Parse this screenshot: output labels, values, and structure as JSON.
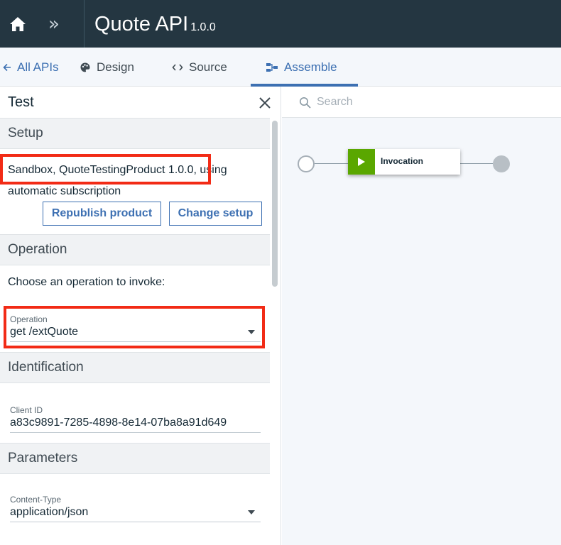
{
  "header": {
    "title": "Quote API",
    "version": "1.0.0"
  },
  "nav": {
    "all_apis": "All APIs",
    "design": "Design",
    "source": "Source",
    "assemble": "Assemble"
  },
  "test_panel": {
    "title": "Test",
    "setup": {
      "heading": "Setup",
      "line1_highlight": "Sandbox, QuoteTestingProduct 1.0.0,",
      "line1_rest": " using",
      "line2": "automatic subscription",
      "republish_label": "Republish product",
      "change_setup_label": "Change setup"
    },
    "operation": {
      "heading": "Operation",
      "prompt": "Choose an operation to invoke:",
      "field_label": "Operation",
      "field_value": "get /extQuote"
    },
    "identification": {
      "heading": "Identification",
      "client_id_label": "Client ID",
      "client_id_value": "a83c9891-7285-4898-8e14-07ba8a91d649"
    },
    "parameters": {
      "heading": "Parameters",
      "content_type_label": "Content-Type",
      "content_type_value": "application/json"
    }
  },
  "canvas": {
    "search_placeholder": "Search",
    "invocation_label": "Invocation"
  },
  "colors": {
    "header_bg": "#243641",
    "accent": "#3d70b2",
    "highlight_box": "#f22b16",
    "invocation_green": "#5aa700"
  }
}
